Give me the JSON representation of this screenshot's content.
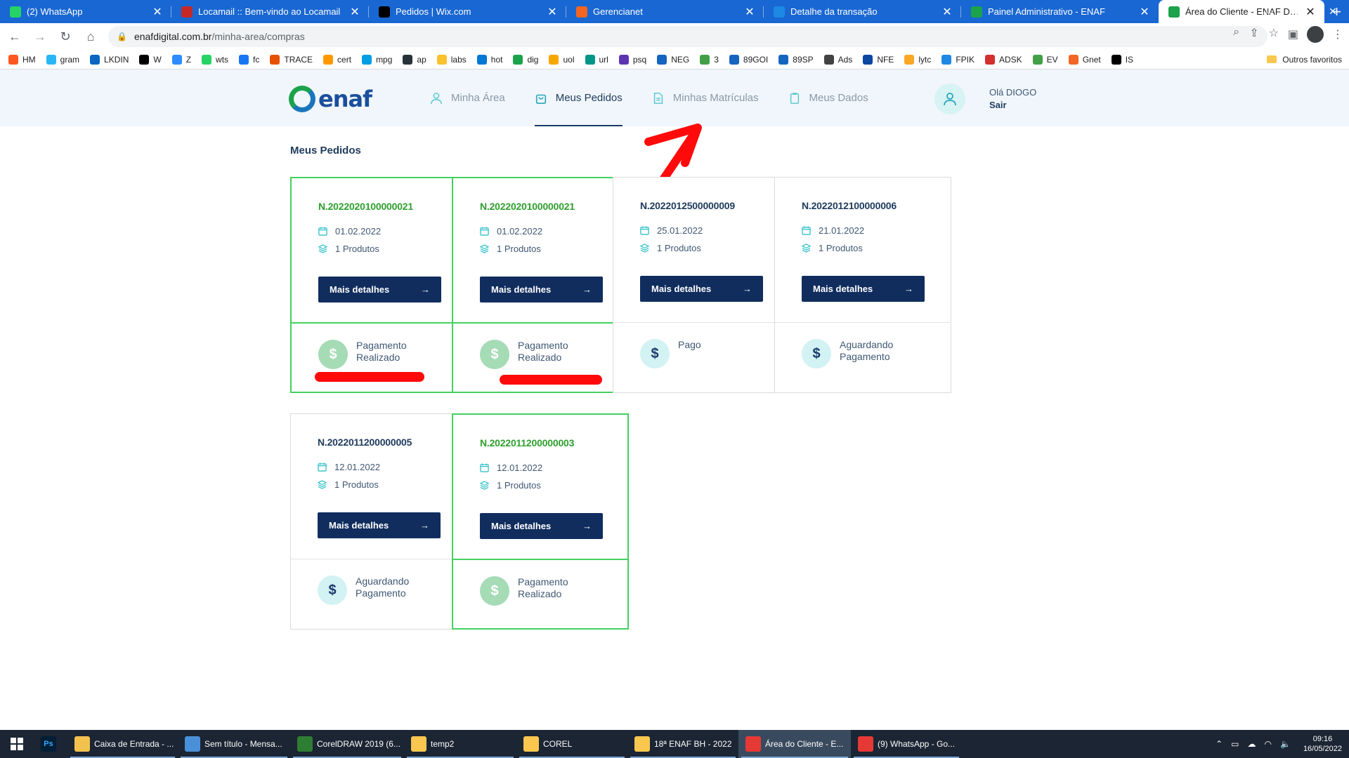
{
  "browser": {
    "tabs": [
      {
        "title": "(2) WhatsApp",
        "icon": "whatsapp-icon",
        "color": "#25d366"
      },
      {
        "title": "Locamail :: Bem-vindo ao Locamail",
        "icon": "locamail-icon",
        "color": "#c62828"
      },
      {
        "title": "Pedidos | Wix.com",
        "icon": "wix-icon",
        "color": "#000000"
      },
      {
        "title": "Gerencianet",
        "icon": "gerencianet-icon",
        "color": "#f26522"
      },
      {
        "title": "Detalhe da transação",
        "icon": "pagseguro-icon",
        "color": "#1e88e5"
      },
      {
        "title": "Painel Administrativo - ENAF",
        "icon": "enaf-icon",
        "color": "#1aa34a"
      },
      {
        "title": "Área do Cliente - ENAF DIGITAL",
        "icon": "enaf-icon",
        "color": "#1aa34a"
      }
    ],
    "url_host": "enafdigital.com.br",
    "url_path": "/minha-area/compras",
    "bookmarks": [
      {
        "label": "HM",
        "color": "#ff5722"
      },
      {
        "label": "gram",
        "color": "#29b6f6"
      },
      {
        "label": "LKDIN",
        "color": "#0a66c2"
      },
      {
        "label": "W",
        "color": "#000000"
      },
      {
        "label": "Z",
        "color": "#2d8cff"
      },
      {
        "label": "wts",
        "color": "#25d366"
      },
      {
        "label": "fc",
        "color": "#1877f2"
      },
      {
        "label": "TRACE",
        "color": "#e65100"
      },
      {
        "label": "cert",
        "color": "#ff9800"
      },
      {
        "label": "mpg",
        "color": "#009ee3"
      },
      {
        "label": "ap",
        "color": "#263238"
      },
      {
        "label": "labs",
        "color": "#fbc02d"
      },
      {
        "label": "hot",
        "color": "#0078d4"
      },
      {
        "label": "dig",
        "color": "#1aa34a"
      },
      {
        "label": "uol",
        "color": "#f7a600"
      },
      {
        "label": "url",
        "color": "#009688"
      },
      {
        "label": "psq",
        "color": "#5e35b1"
      },
      {
        "label": "NEG",
        "color": "#1565c0"
      },
      {
        "label": "3",
        "color": "#43a047"
      },
      {
        "label": "89GOI",
        "color": "#1565c0"
      },
      {
        "label": "89SP",
        "color": "#1565c0"
      },
      {
        "label": "Ads",
        "color": "#424242"
      },
      {
        "label": "NFE",
        "color": "#0d47a1"
      },
      {
        "label": "lytc",
        "color": "#f9a825"
      },
      {
        "label": "FPIK",
        "color": "#1e88e5"
      },
      {
        "label": "ADSK",
        "color": "#d32f2f"
      },
      {
        "label": "EV",
        "color": "#43a047"
      },
      {
        "label": "Gnet",
        "color": "#f26522"
      },
      {
        "label": "IS",
        "color": "#000000"
      }
    ],
    "other_bookmarks": "Outros favoritos"
  },
  "site": {
    "nav": [
      {
        "label": "Minha Área",
        "icon": "user-icon"
      },
      {
        "label": "Meus Pedidos",
        "icon": "bag-icon"
      },
      {
        "label": "Minhas Matrículas",
        "icon": "document-icon"
      },
      {
        "label": "Meus Dados",
        "icon": "clipboard-icon"
      }
    ],
    "user_greeting": "Olá DIOGO",
    "logout_label": "Sair",
    "logo_text": "enaf"
  },
  "page": {
    "title": "Meus Pedidos",
    "details_label": "Mais detalhes",
    "orders": [
      {
        "number": "N.2022020100000021",
        "date": "01.02.2022",
        "products": "1 Produtos",
        "status": [
          "Pagamento",
          "Realizado"
        ],
        "status_type": "paid-ok",
        "highlight": true
      },
      {
        "number": "N.2022020100000021",
        "date": "01.02.2022",
        "products": "1 Produtos",
        "status": [
          "Pagamento",
          "Realizado"
        ],
        "status_type": "paid-ok",
        "highlight": true
      },
      {
        "number": "N.2022012500000009",
        "date": "25.01.2022",
        "products": "1 Produtos",
        "status": [
          "Pago",
          ""
        ],
        "status_type": "pending",
        "highlight": false
      },
      {
        "number": "N.2022012100000006",
        "date": "21.01.2022",
        "products": "1 Produtos",
        "status": [
          "Aguardando",
          "Pagamento"
        ],
        "status_type": "pending",
        "highlight": false
      },
      {
        "number": "N.2022011200000005",
        "date": "12.01.2022",
        "products": "1 Produtos",
        "status": [
          "Aguardando",
          "Pagamento"
        ],
        "status_type": "pending",
        "highlight": false
      },
      {
        "number": "N.2022011200000003",
        "date": "12.01.2022",
        "products": "1 Produtos",
        "status": [
          "Pagamento",
          "Realizado"
        ],
        "status_type": "paid-ok",
        "highlight": true
      }
    ]
  },
  "taskbar": {
    "items": [
      {
        "label": "Caixa de Entrada - ...",
        "color": "#f2c14e"
      },
      {
        "label": "Sem título - Mensa...",
        "color": "#4a90d9"
      },
      {
        "label": "CorelDRAW 2019 (6...",
        "color": "#2e7d32"
      },
      {
        "label": "temp2",
        "color": "#f9c74f"
      },
      {
        "label": "COREL",
        "color": "#f9c74f"
      },
      {
        "label": "18ª ENAF BH - 2022",
        "color": "#f9c74f"
      },
      {
        "label": "Área do Cliente - E...",
        "color": "#e53935"
      },
      {
        "label": "(9) WhatsApp - Go...",
        "color": "#e53935"
      }
    ],
    "time": "09:16",
    "date": "16/05/2022"
  }
}
